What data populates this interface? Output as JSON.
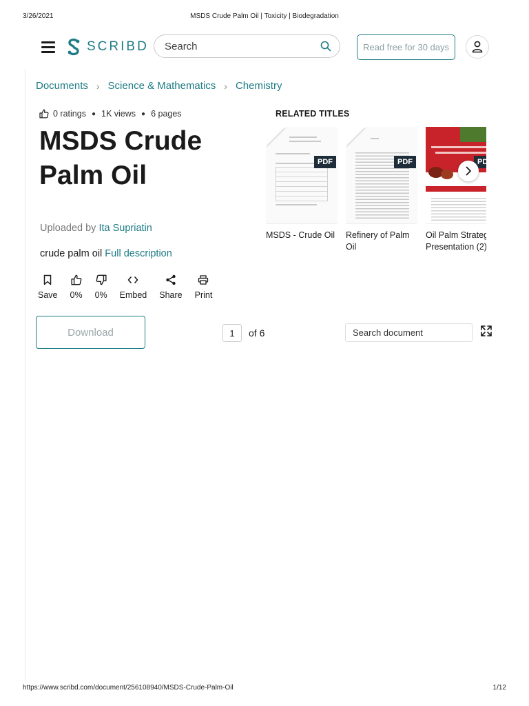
{
  "print_header": {
    "date": "3/26/2021",
    "title": "MSDS Crude Palm Oil | Toxicity | Biodegradation"
  },
  "print_footer": {
    "url": "https://www.scribd.com/document/256108940/MSDS-Crude-Palm-Oil",
    "page": "1/12"
  },
  "nav": {
    "logo_text": "SCRIBD",
    "search_placeholder": "Search",
    "read_free_label": "Read free for 30 days",
    "brand_color": "#1e7b85"
  },
  "breadcrumb": [
    "Documents",
    "Science & Mathematics",
    "Chemistry"
  ],
  "document": {
    "ratings": "0 ratings",
    "views": "1K views",
    "pages": "6 pages",
    "title": "MSDS Crude Palm Oil",
    "uploaded_by_label": "Uploaded by",
    "uploader": "Ita Supriatin",
    "description": "crude palm oil",
    "full_description_label": "Full description"
  },
  "actions": [
    {
      "label": "Save",
      "icon": "bookmark-icon"
    },
    {
      "label": "0%",
      "icon": "thumbs-up-icon"
    },
    {
      "label": "0%",
      "icon": "thumbs-down-icon"
    },
    {
      "label": "Embed",
      "icon": "code-icon"
    },
    {
      "label": "Share",
      "icon": "share-icon"
    },
    {
      "label": "Print",
      "icon": "printer-icon"
    }
  ],
  "toolbar": {
    "download_label": "Download",
    "current_page": "1",
    "of_pages": "of 6",
    "search_placeholder": "Search document"
  },
  "related": {
    "header": "RELATED TITLES",
    "items": [
      {
        "title_line1": "MSDS - Crude Oil",
        "title_line2": "",
        "badge": "PDF"
      },
      {
        "title_line1": "Refinery of Palm",
        "title_line2": "Oil",
        "badge": "PDF"
      },
      {
        "title_line1": "Oil Palm Strateg",
        "title_line2": "Presentation (2)",
        "badge": "PDF"
      }
    ]
  }
}
